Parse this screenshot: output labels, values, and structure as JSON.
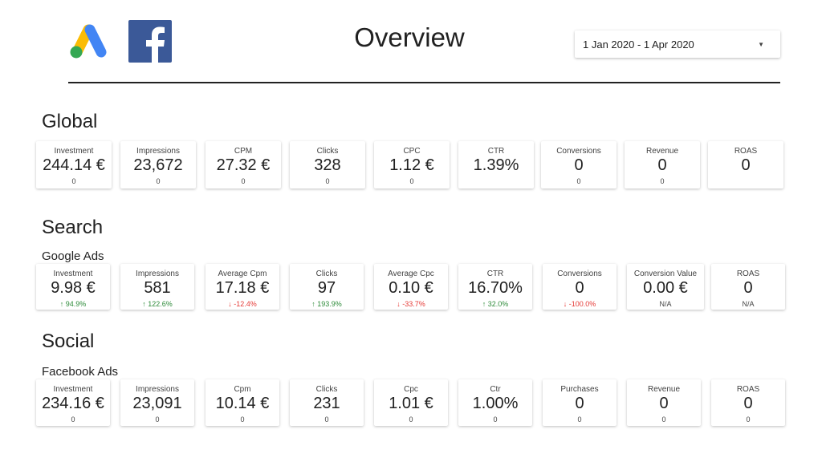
{
  "header": {
    "title": "Overview",
    "date_range": "1 Jan 2020 - 1 Apr 2020",
    "logos": [
      "google-ads-logo",
      "facebook-logo"
    ],
    "colors": {
      "fb_blue": "#3b5998",
      "ads_blue": "#4285f4",
      "ads_yellow": "#fbbc04",
      "ads_green": "#34a853",
      "up": "#2e8b3a",
      "down": "#e53935"
    }
  },
  "global": {
    "title": "Global",
    "cards": [
      {
        "label": "Investment",
        "value": "244.14 €",
        "delta": "0"
      },
      {
        "label": "Impressions",
        "value": "23,672",
        "delta": "0"
      },
      {
        "label": "CPM",
        "value": "27.32 €",
        "delta": "0"
      },
      {
        "label": "Clicks",
        "value": "328",
        "delta": "0"
      },
      {
        "label": "CPC",
        "value": "1.12 €",
        "delta": "0"
      },
      {
        "label": "CTR",
        "value": "1.39%",
        "delta": ""
      },
      {
        "label": "Conversions",
        "value": "0",
        "delta": "0"
      },
      {
        "label": "Revenue",
        "value": "0",
        "delta": "0"
      },
      {
        "label": "ROAS",
        "value": "0",
        "delta": ""
      }
    ]
  },
  "search": {
    "title": "Search",
    "subtitle": "Google Ads",
    "cards": [
      {
        "label": "Investment",
        "value": "9.98 €",
        "delta": "94.9%",
        "trend": "up"
      },
      {
        "label": "Impressions",
        "value": "581",
        "delta": "122.6%",
        "trend": "up"
      },
      {
        "label": "Average Cpm",
        "value": "17.18 €",
        "delta": "-12.4%",
        "trend": "down"
      },
      {
        "label": "Clicks",
        "value": "97",
        "delta": "193.9%",
        "trend": "up"
      },
      {
        "label": "Average Cpc",
        "value": "0.10 €",
        "delta": "-33.7%",
        "trend": "down"
      },
      {
        "label": "CTR",
        "value": "16.70%",
        "delta": "32.0%",
        "trend": "up"
      },
      {
        "label": "Conversions",
        "value": "0",
        "delta": "-100.0%",
        "trend": "down"
      },
      {
        "label": "Conversion Value",
        "value": "0.00 €",
        "delta": "N/A",
        "trend": "none"
      },
      {
        "label": "ROAS",
        "value": "0",
        "delta": "N/A",
        "trend": "none"
      }
    ]
  },
  "social": {
    "title": "Social",
    "subtitle": "Facebook Ads",
    "cards": [
      {
        "label": "Investment",
        "value": "234.16 €",
        "delta": "0"
      },
      {
        "label": "Impressions",
        "value": "23,091",
        "delta": "0"
      },
      {
        "label": "Cpm",
        "value": "10.14 €",
        "delta": "0"
      },
      {
        "label": "Clicks",
        "value": "231",
        "delta": "0"
      },
      {
        "label": "Cpc",
        "value": "1.01 €",
        "delta": "0"
      },
      {
        "label": "Ctr",
        "value": "1.00%",
        "delta": "0"
      },
      {
        "label": "Purchases",
        "value": "0",
        "delta": "0"
      },
      {
        "label": "Revenue",
        "value": "0",
        "delta": "0"
      },
      {
        "label": "ROAS",
        "value": "0",
        "delta": "0"
      }
    ]
  }
}
